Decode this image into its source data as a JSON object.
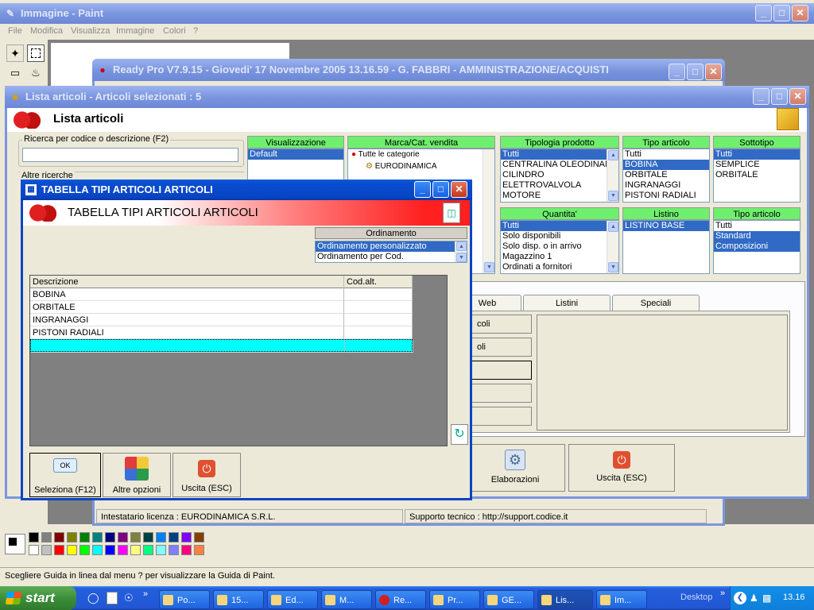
{
  "paint": {
    "title": "Immagine - Paint",
    "menu": [
      "File",
      "Modifica",
      "Visualizza",
      "Immagine",
      "Colori",
      "?"
    ],
    "status": "Scegliere Guida in linea dal menu ? per visualizzare la Guida di Paint.",
    "palette_top": [
      "#000000",
      "#808080",
      "#800000",
      "#808000",
      "#008000",
      "#008080",
      "#000080",
      "#800080",
      "#808040",
      "#004040",
      "#0080ff",
      "#004080",
      "#8000ff",
      "#804000"
    ],
    "palette_bottom": [
      "#ffffff",
      "#c0c0c0",
      "#ff0000",
      "#ffff00",
      "#00ff00",
      "#00ffff",
      "#0000ff",
      "#ff00ff",
      "#ffff80",
      "#00ff80",
      "#80ffff",
      "#8080ff",
      "#ff0080",
      "#ff8040"
    ]
  },
  "readypro": {
    "title": "Ready Pro V7.9.15 - Giovedi' 17 Novembre 2005  13.16.59 - G. FABBRI - AMMINISTRAZIONE/ACQUISTI",
    "license": "Intestatario licenza : EURODINAMICA S.R.L.",
    "support": "Supporto tecnico : http://support.codice.it"
  },
  "lista": {
    "title": "Lista articoli - Articoli selezionati : 5",
    "header": "Lista articoli",
    "search_label": "Ricerca per codice o descrizione (F2)",
    "search_value": "",
    "other_search": "Altre ricerche",
    "visualizzazione": {
      "label": "Visualizzazione",
      "items": [
        "Default"
      ]
    },
    "marca": {
      "label": "Marca/Cat. vendita",
      "items": [
        "Tutte le categorie",
        "EURODINAMICA"
      ]
    },
    "tipologia": {
      "label": "Tipologia prodotto",
      "items": [
        "Tutti",
        "CENTRALINA OLEODINAMICA",
        "CILINDRO",
        "ELETTROVALVOLA",
        "MOTORE"
      ]
    },
    "tipo_articolo": {
      "label": "Tipo articolo",
      "items": [
        "Tutti",
        "BOBINA",
        "ORBITALE",
        "INGRANAGGI",
        "PISTONI RADIALI"
      ]
    },
    "sottotipo": {
      "label": "Sottotipo",
      "items": [
        "Tutti",
        "SEMPLICE",
        "ORBITALE"
      ]
    },
    "quantita": {
      "label": "Quantita'",
      "items": [
        "Tutti",
        "Solo disponibili",
        "Solo disp. o in arrivo",
        "Magazzino 1",
        "Ordinati a fornitori"
      ]
    },
    "listino": {
      "label": "Listino",
      "items": [
        "LISTINO BASE"
      ]
    },
    "tipo_articolo2": {
      "label": "Tipo articolo",
      "items": [
        "Tutti",
        "Standard",
        "Composizioni"
      ]
    },
    "tabs": [
      "Web",
      "Listini",
      "Speciali"
    ],
    "side_buttons": [
      "coli",
      "oli"
    ],
    "elaborazioni": "Elaborazioni",
    "uscita": "Uscita (ESC)"
  },
  "dialog": {
    "title": "TABELLA TIPI ARTICOLI ARTICOLI",
    "header": "TABELLA TIPI ARTICOLI ARTICOLI",
    "ordinamento": {
      "label": "Ordinamento",
      "items": [
        "Ordinamento personalizzato",
        "Ordinamento per Cod."
      ]
    },
    "columns": [
      "Descrizione",
      "Cod.alt."
    ],
    "rows": [
      [
        "BOBINA",
        ""
      ],
      [
        "ORBITALE",
        ""
      ],
      [
        "INGRANAGGI",
        ""
      ],
      [
        "PISTONI RADIALI",
        ""
      ]
    ],
    "buttons": {
      "seleziona": "Seleziona (F12)",
      "altre": "Altre opzioni",
      "uscita": "Uscita (ESC)",
      "ok_icon_text": "OK"
    }
  },
  "taskbar": {
    "start": "start",
    "items": [
      "Po...",
      "15...",
      "Ed...",
      "M...",
      "Re...",
      "Pr...",
      "GE...",
      "Lis...",
      "Im..."
    ],
    "desktop": "Desktop",
    "clock": "13.16"
  },
  "colors": {
    "accent_green": "#6ef06e",
    "selection": "#316ac5",
    "new_row": "#00ffff"
  }
}
